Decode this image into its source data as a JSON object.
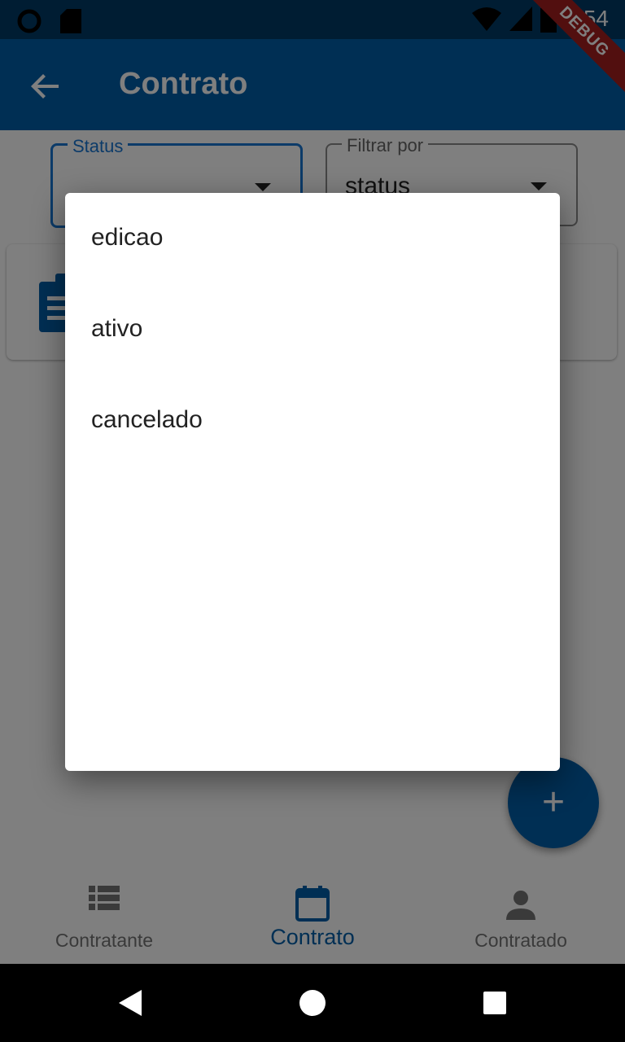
{
  "status_bar": {
    "time": "5:54",
    "icons": [
      "circle-notification-icon",
      "sd-card-icon",
      "wifi-icon",
      "signal-icon",
      "battery-icon"
    ]
  },
  "app_bar": {
    "title": "Contrato",
    "back_icon": "arrow-back-icon",
    "background": "#005ea8"
  },
  "debug_banner": "DEBUG",
  "filters": {
    "status": {
      "label": "Status",
      "value": ""
    },
    "filter_by": {
      "label": "Filtrar por",
      "value": "status"
    }
  },
  "card": {
    "icon": "clipboard-icon"
  },
  "fab": {
    "icon": "plus-icon",
    "label": "+"
  },
  "bottom_nav": {
    "items": [
      {
        "label": "Contratante",
        "icon": "list-icon",
        "active": false
      },
      {
        "label": "Contrato",
        "icon": "calendar-icon",
        "active": true
      },
      {
        "label": "Contratado",
        "icon": "person-icon",
        "active": false
      }
    ],
    "active_color": "#005ea8",
    "inactive_color": "#757575"
  },
  "dialog": {
    "options": [
      "edicao",
      "ativo",
      "cancelado"
    ]
  },
  "system_nav": {
    "icons": [
      "back-triangle-icon",
      "home-circle-icon",
      "recents-square-icon"
    ]
  }
}
